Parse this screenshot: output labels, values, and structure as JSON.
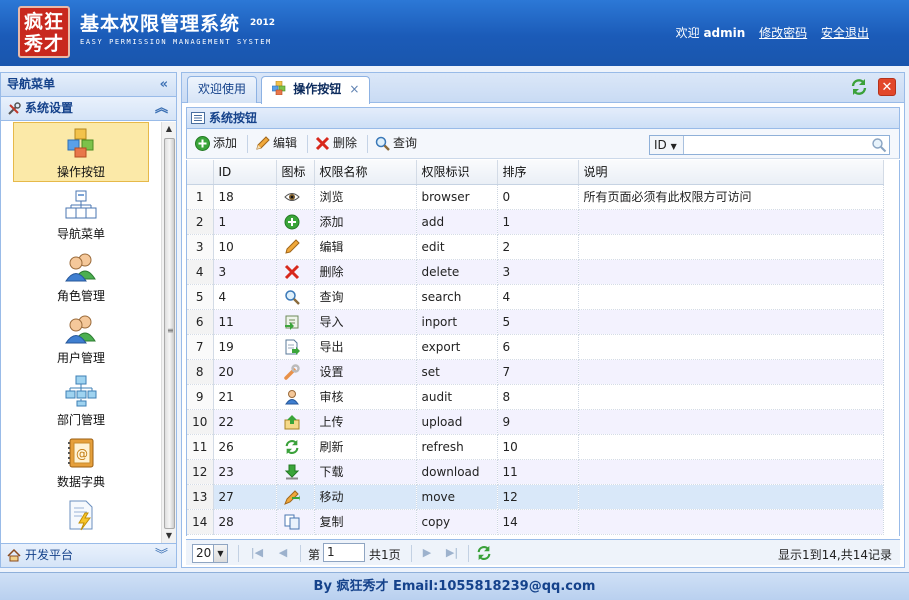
{
  "header": {
    "logo_text": "疯狂\n秀才",
    "title": "基本权限管理系统",
    "year": "2012",
    "subtitle": "EASY PERMISSION MANAGEMENT SYSTEM",
    "welcome": "欢迎",
    "user": "admin",
    "change_password": "修改密码",
    "logout": "安全退出"
  },
  "sidebar": {
    "title": "导航菜单",
    "section": "系统设置",
    "footer_section": "开发平台",
    "items": [
      {
        "label": "操作按钮",
        "icon": "blocks-icon",
        "active": true
      },
      {
        "label": "导航菜单",
        "icon": "sitemap-icon",
        "active": false
      },
      {
        "label": "角色管理",
        "icon": "users-icon",
        "active": false
      },
      {
        "label": "用户管理",
        "icon": "users-icon",
        "active": false
      },
      {
        "label": "部门管理",
        "icon": "org-chart-icon",
        "active": false
      },
      {
        "label": "数据字典",
        "icon": "address-book-icon",
        "active": false
      },
      {
        "label": "",
        "icon": "document-bolt-icon",
        "active": false
      }
    ]
  },
  "tabs": [
    {
      "label": "欢迎使用",
      "active": false,
      "closable": false
    },
    {
      "label": "操作按钮",
      "active": true,
      "closable": true,
      "close": "×"
    }
  ],
  "grid": {
    "title": "系统按钮",
    "toolbar": {
      "add": "添加",
      "edit": "编辑",
      "delete": "删除",
      "query": "查询",
      "search_field": "ID",
      "search_value": ""
    },
    "columns": [
      "ID",
      "图标",
      "权限名称",
      "权限标识",
      "排序",
      "说明"
    ],
    "rows": [
      {
        "rn": "1",
        "id": "18",
        "icon": "eye-icon",
        "name": "浏览",
        "key": "browser",
        "sort": "0",
        "desc": "所有页面必须有此权限方可访问"
      },
      {
        "rn": "2",
        "id": "1",
        "icon": "add-icon",
        "name": "添加",
        "key": "add",
        "sort": "1",
        "desc": ""
      },
      {
        "rn": "3",
        "id": "10",
        "icon": "pencil-icon",
        "name": "编辑",
        "key": "edit",
        "sort": "2",
        "desc": ""
      },
      {
        "rn": "4",
        "id": "3",
        "icon": "delete-icon",
        "name": "删除",
        "key": "delete",
        "sort": "3",
        "desc": ""
      },
      {
        "rn": "5",
        "id": "4",
        "icon": "search-icon",
        "name": "查询",
        "key": "search",
        "sort": "4",
        "desc": ""
      },
      {
        "rn": "6",
        "id": "11",
        "icon": "import-icon",
        "name": "导入",
        "key": "inport",
        "sort": "5",
        "desc": ""
      },
      {
        "rn": "7",
        "id": "19",
        "icon": "export-icon",
        "name": "导出",
        "key": "export",
        "sort": "6",
        "desc": ""
      },
      {
        "rn": "8",
        "id": "20",
        "icon": "wrench-icon",
        "name": "设置",
        "key": "set",
        "sort": "7",
        "desc": ""
      },
      {
        "rn": "9",
        "id": "21",
        "icon": "user-audit-icon",
        "name": "审核",
        "key": "audit",
        "sort": "8",
        "desc": ""
      },
      {
        "rn": "10",
        "id": "22",
        "icon": "upload-icon",
        "name": "上传",
        "key": "upload",
        "sort": "9",
        "desc": ""
      },
      {
        "rn": "11",
        "id": "26",
        "icon": "refresh-icon",
        "name": "刷新",
        "key": "refresh",
        "sort": "10",
        "desc": ""
      },
      {
        "rn": "12",
        "id": "23",
        "icon": "download-icon",
        "name": "下载",
        "key": "download",
        "sort": "11",
        "desc": ""
      },
      {
        "rn": "13",
        "id": "27",
        "icon": "move-icon",
        "name": "移动",
        "key": "move",
        "sort": "12",
        "desc": ""
      },
      {
        "rn": "14",
        "id": "28",
        "icon": "copy-icon",
        "name": "复制",
        "key": "copy",
        "sort": "14",
        "desc": ""
      }
    ],
    "selected_row": 13
  },
  "pager": {
    "page_size": "20",
    "page_prefix": "第",
    "page": "1",
    "page_total": "共1页",
    "info": "显示1到14,共14记录"
  },
  "footer": {
    "text": "By 疯狂秀才 Email:1055818239@qq.com"
  },
  "colors": {
    "header_blue": "#1b5bb8",
    "panel_border": "#99bbe8",
    "active_nav": "#fbe9a8",
    "close_red": "#e2472a"
  }
}
